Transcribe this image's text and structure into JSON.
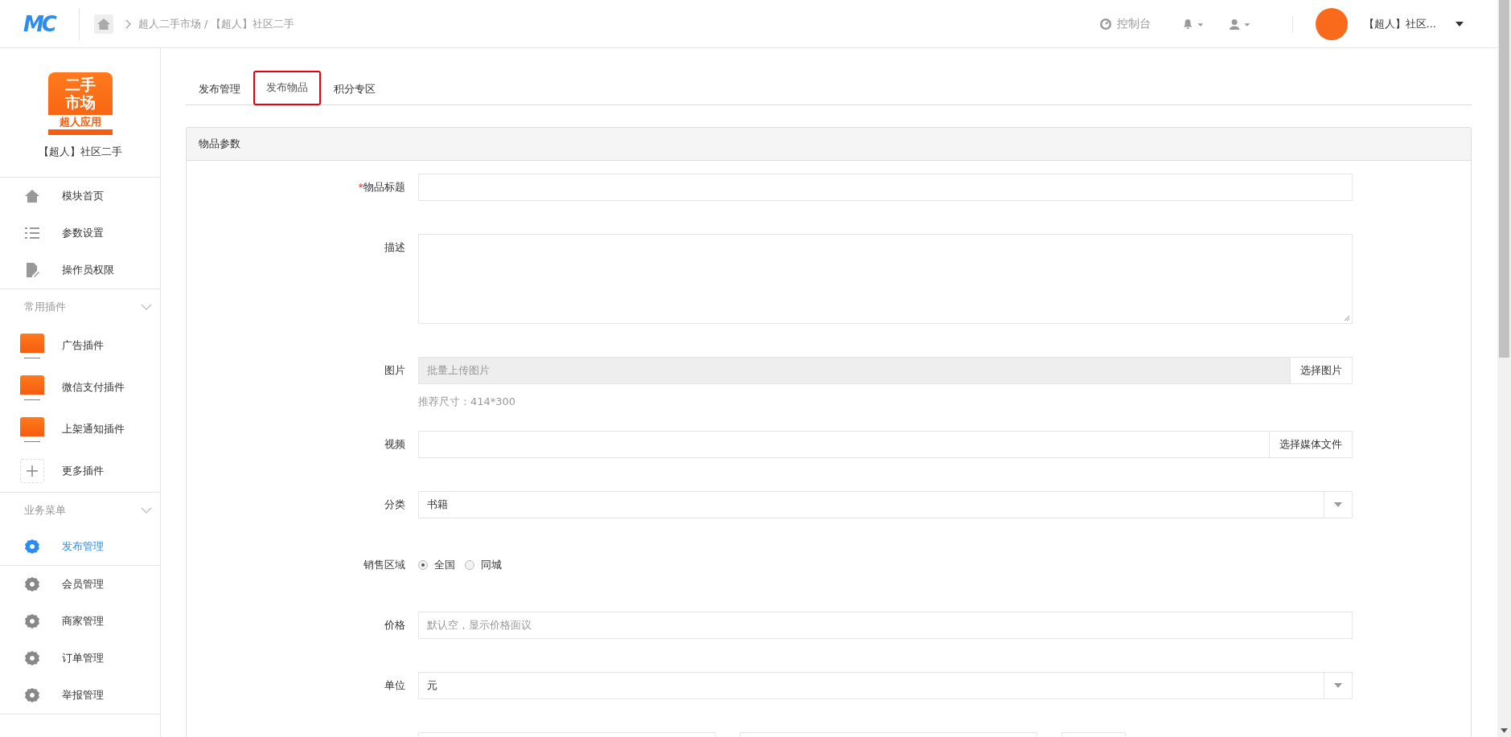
{
  "header": {
    "logo": "MC",
    "breadcrumb": [
      "超人二手市场",
      "【超人】社区二手"
    ],
    "breadcrumb_sep": "/",
    "console": "控制台",
    "account": "【超人】社区..."
  },
  "sidebar": {
    "app_icon": {
      "line1": "二手",
      "line2": "市场",
      "caption": "超人应用"
    },
    "app_name": "【超人】社区二手",
    "groups": [
      {
        "items": [
          {
            "label": "模块首页",
            "kind": "home",
            "selected": false
          },
          {
            "label": "参数设置",
            "kind": "list",
            "selected": false
          },
          {
            "label": "操作员权限",
            "kind": "doc",
            "selected": false
          }
        ]
      },
      {
        "title": "常用插件",
        "expanded": true,
        "items": [
          {
            "label": "广告插件",
            "kind": "plugin",
            "selected": false
          },
          {
            "label": "微信支付插件",
            "kind": "plugin",
            "selected": false
          },
          {
            "label": "上架通知插件",
            "kind": "plugin",
            "selected": false
          },
          {
            "label": "更多插件",
            "kind": "plus",
            "selected": false
          }
        ]
      },
      {
        "title": "业务菜单",
        "expanded": true,
        "items": [
          {
            "label": "发布管理",
            "kind": "gear",
            "selected": true
          },
          {
            "label": "会员管理",
            "kind": "gear",
            "selected": false
          },
          {
            "label": "商家管理",
            "kind": "gear",
            "selected": false
          },
          {
            "label": "订单管理",
            "kind": "gear",
            "selected": false
          },
          {
            "label": "举报管理",
            "kind": "gear",
            "selected": false
          }
        ]
      }
    ]
  },
  "tabs": [
    {
      "label": "发布管理",
      "selected": false,
      "highlighted": false
    },
    {
      "label": "发布物品",
      "selected": true,
      "highlighted": true
    },
    {
      "label": "积分专区",
      "selected": false,
      "highlighted": false
    }
  ],
  "panel": {
    "title": "物品参数",
    "fields": [
      {
        "kind": "text",
        "label": "物品标题",
        "required_mark": "*"
      },
      {
        "kind": "textarea",
        "label": "描述"
      },
      {
        "kind": "upload",
        "label": "图片",
        "readonly": true,
        "placeholder": "批量上传图片",
        "button": "选择图片",
        "hint": "推荐尺寸：414*300"
      },
      {
        "kind": "upload",
        "label": "视频",
        "readonly": false,
        "button": "选择媒体文件"
      },
      {
        "kind": "select",
        "label": "分类",
        "value": "书籍"
      },
      {
        "kind": "radio",
        "label": "销售区域",
        "options": [
          {
            "label": "全国",
            "selected": true
          },
          {
            "label": "同城",
            "selected": false
          }
        ]
      },
      {
        "kind": "text",
        "label": "价格",
        "placeholder": "默认空，显示价格面议"
      },
      {
        "kind": "select",
        "label": "单位",
        "value": "元"
      }
    ]
  }
}
